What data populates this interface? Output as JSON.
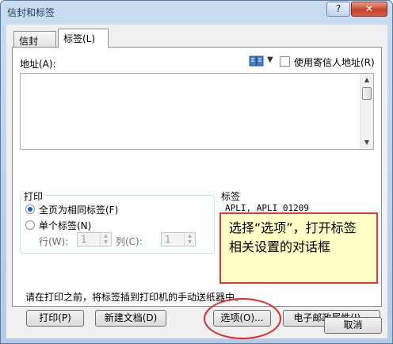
{
  "window": {
    "title": "信封和标签",
    "help_label": "?",
    "close_label": "✕"
  },
  "tabs": [
    {
      "label": "信封(E)"
    },
    {
      "label": "标签(L)"
    }
  ],
  "address": {
    "label": "地址(A):",
    "value": "",
    "book_icon": "address-book-icon",
    "return_address_label": "使用寄信人地址(R)",
    "return_address_checked": false
  },
  "print": {
    "title": "打印",
    "option_full_page": "全页为相同标签(F)",
    "option_single": "单个标签(N)",
    "selected": "full_page",
    "row_label": "行(W):",
    "row_value": "1",
    "col_label": "列(C):",
    "col_value": "1"
  },
  "label": {
    "title": "标签",
    "name": "APLI, APLI 01209"
  },
  "annotation": {
    "note": "选择“选项”，打开标签相关设置的对话框",
    "note_border_color": "#e23a3a",
    "note_bg_color": "#fffec6"
  },
  "hint": "请在打印之前，将标签插到打印机的手动送纸器中。",
  "buttons": {
    "print": "打印(P)",
    "new_document": "新建文档(D)",
    "options": "选项(O)...",
    "epostage": "电子邮政属性(I)...",
    "cancel": "取消"
  }
}
